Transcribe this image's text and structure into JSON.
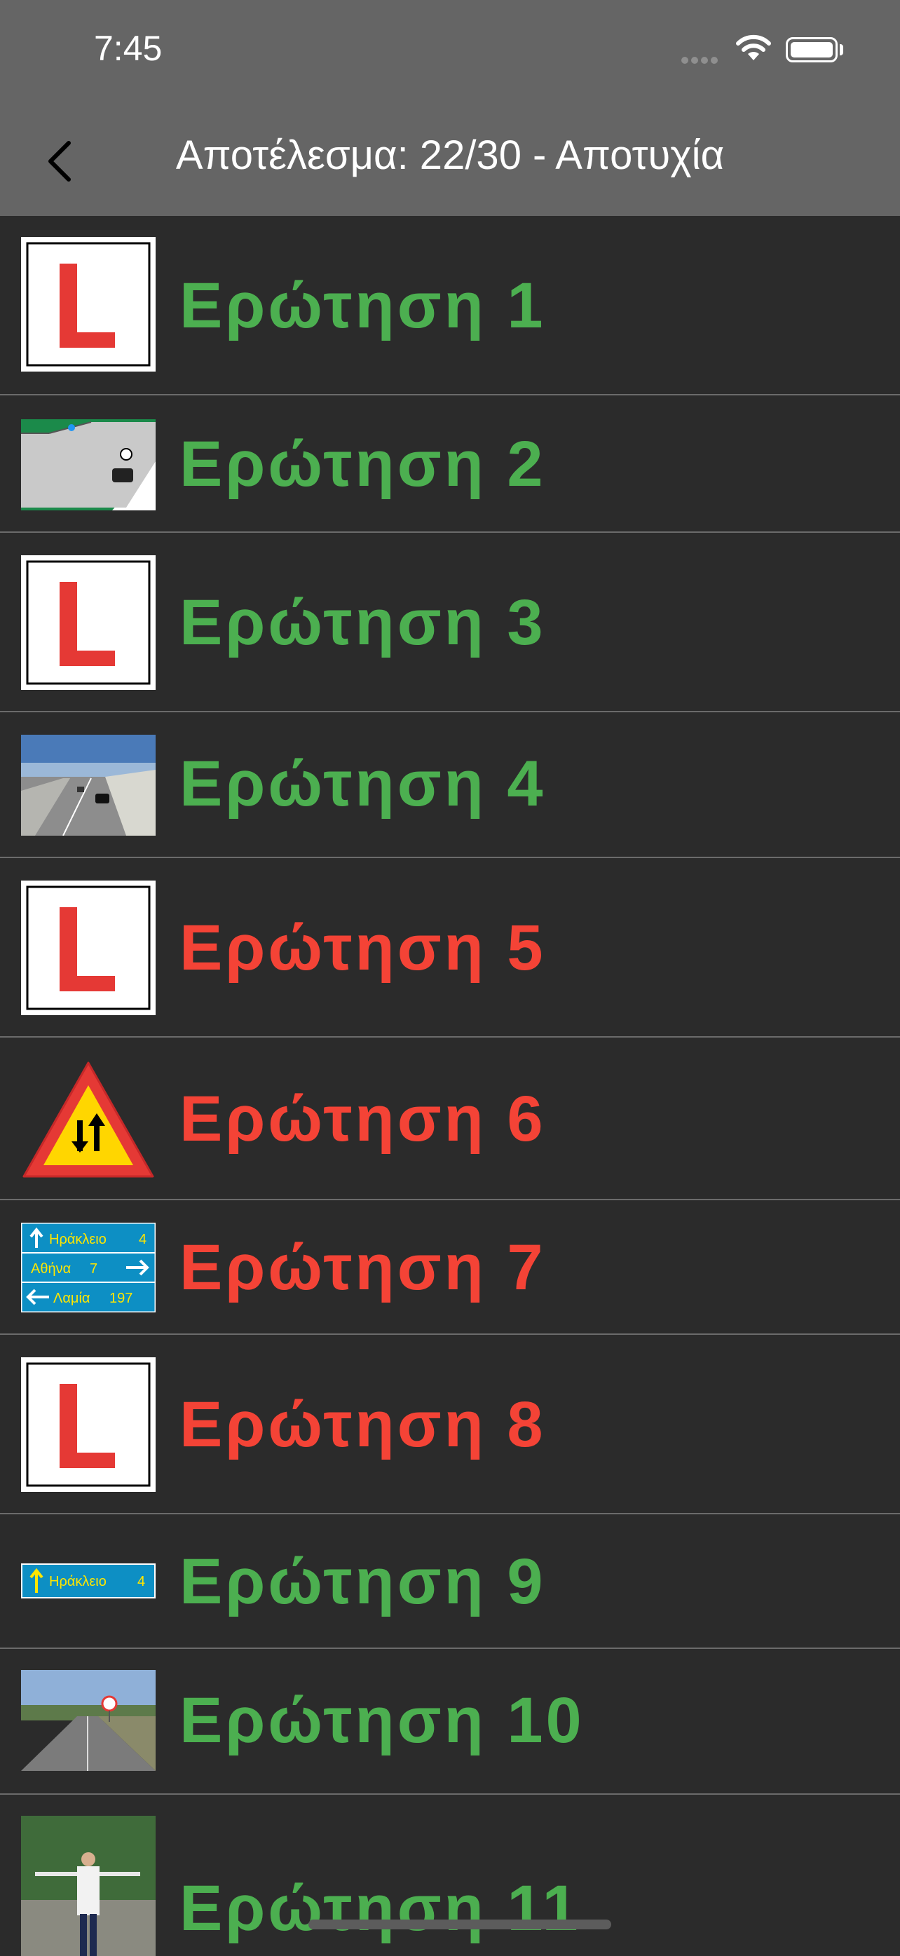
{
  "status_bar": {
    "time": "7:45"
  },
  "nav": {
    "title": "Αποτέλεσμα: 22/30 - Αποτυχία",
    "back_icon": "chevron-left-icon"
  },
  "colors": {
    "correct": "#4caf50",
    "wrong": "#f44336",
    "background": "#2b2b2b",
    "header": "#656565"
  },
  "questions": [
    {
      "label": "Ερώτηση 1",
      "result": "correct",
      "image": "learner-L-sign"
    },
    {
      "label": "Ερώτηση 2",
      "result": "correct",
      "image": "intersection-diagram"
    },
    {
      "label": "Ερώτηση 3",
      "result": "correct",
      "image": "learner-L-sign"
    },
    {
      "label": "Ερώτηση 4",
      "result": "correct",
      "image": "highway-photo"
    },
    {
      "label": "Ερώτηση 5",
      "result": "wrong",
      "image": "learner-L-sign"
    },
    {
      "label": "Ερώτηση 6",
      "result": "wrong",
      "image": "two-way-traffic-sign"
    },
    {
      "label": "Ερώτηση 7",
      "result": "wrong",
      "image": "direction-sign",
      "sign_lines": [
        "Ηράκλειο",
        "4",
        "Αθήνα",
        "7",
        "Λαμία",
        "197"
      ]
    },
    {
      "label": "Ερώτηση 8",
      "result": "wrong",
      "image": "learner-L-sign"
    },
    {
      "label": "Ερώτηση 9",
      "result": "correct",
      "image": "direction-sign-single",
      "sign_lines": [
        "Ηράκλειο",
        "4"
      ]
    },
    {
      "label": "Ερώτηση 10",
      "result": "correct",
      "image": "road-photo"
    },
    {
      "label": "Ερώτηση 11",
      "result": "correct",
      "image": "traffic-police-photo"
    }
  ]
}
